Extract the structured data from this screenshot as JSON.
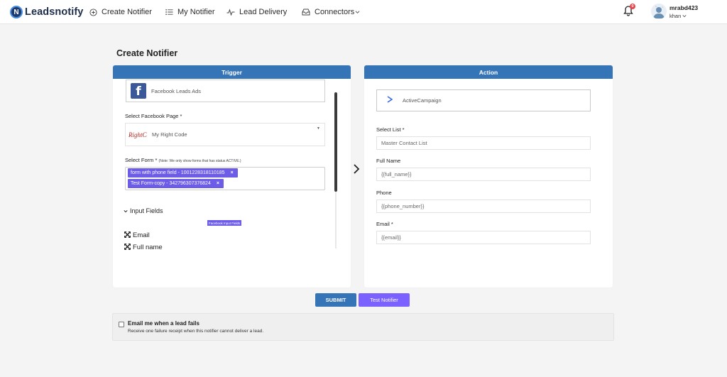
{
  "nav": {
    "brand": "Leadsnotify",
    "items": [
      {
        "label": "Create Notifier",
        "icon": "plus-circle-icon"
      },
      {
        "label": "My Notifier",
        "icon": "list-icon"
      },
      {
        "label": "Lead Delivery",
        "icon": "activity-icon"
      },
      {
        "label": "Connectors",
        "icon": "inbox-icon"
      }
    ],
    "notification_count": "0",
    "user": {
      "name": "mrabd423",
      "sub": "khan"
    }
  },
  "page": {
    "title": "Create Notifier"
  },
  "trigger": {
    "header": "Trigger",
    "app_name": "Facebook Leads Ads",
    "page_label": "Select Facebook Page *",
    "page_logo_text": "RightCo",
    "page_value": "My Right Code",
    "form_label": "Select Form *",
    "form_note": "(Note: We only show forms that has status ACTIVE.)",
    "forms": [
      "form with phone field - 1001228318110185",
      "Test Form-copy - 342796307376824"
    ],
    "input_fields_title": "Input Fields",
    "fb_input_tag": "Facebook Input Fields",
    "fields": [
      "Email",
      "Full name"
    ]
  },
  "action": {
    "header": "Action",
    "app_name": "ActiveCampaign",
    "list_label": "Select List *",
    "list_value": "Master Contact List",
    "fullname_label": "Full Name",
    "fullname_value": "{{full_name}}",
    "phone_label": "Phone",
    "phone_value": "{{phone_number}}",
    "email_label": "Email *",
    "email_value": "{{email}}"
  },
  "buttons": {
    "submit": "SUBMIT",
    "test": "Test Notifier"
  },
  "notify": {
    "title": "Email me when a lead fails",
    "subtitle": "Receive one failure receipt when this notifier cannot deliver a lead."
  },
  "colors": {
    "primary": "#3674b8",
    "accent": "#6c5ce7",
    "brand_dark": "#1d3a6e"
  }
}
